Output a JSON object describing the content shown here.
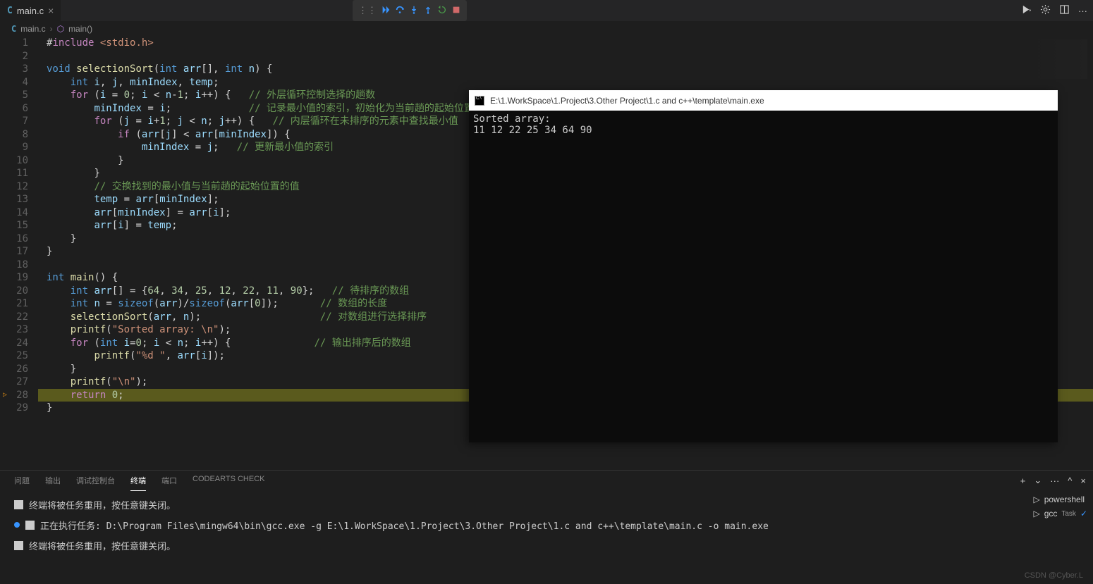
{
  "tab": {
    "filename": "main.c",
    "icon_letter": "C"
  },
  "breadcrumb": {
    "file": "main.c",
    "func": "main()"
  },
  "toolbar_icons": [
    "drag",
    "continue",
    "step-over",
    "step-into",
    "step-out",
    "restart",
    "stop"
  ],
  "right_icons": [
    "run-dropdown",
    "settings",
    "split",
    "more"
  ],
  "code": [
    {
      "n": 1,
      "html": "<span class='op'>#</span><span class='ctl'>include</span> <span class='str'>&lt;stdio.h&gt;</span>"
    },
    {
      "n": 2,
      "html": ""
    },
    {
      "n": 3,
      "html": "<span class='type'>void</span> <span class='fn'>selectionSort</span><span class='pn'>(</span><span class='type'>int</span> <span class='var'>arr</span><span class='pn'>[],</span> <span class='type'>int</span> <span class='var'>n</span><span class='pn'>)</span> <span class='pn'>{</span>"
    },
    {
      "n": 4,
      "html": "    <span class='type'>int</span> <span class='var'>i</span><span class='pn'>,</span> <span class='var'>j</span><span class='pn'>,</span> <span class='var'>minIndex</span><span class='pn'>,</span> <span class='var'>temp</span><span class='pn'>;</span>"
    },
    {
      "n": 5,
      "html": "    <span class='ctl'>for</span> <span class='pn'>(</span><span class='var'>i</span> <span class='op'>=</span> <span class='num'>0</span><span class='pn'>;</span> <span class='var'>i</span> <span class='op'>&lt;</span> <span class='var'>n</span><span class='op'>-</span><span class='num'>1</span><span class='pn'>;</span> <span class='var'>i</span><span class='op'>++</span><span class='pn'>)</span> <span class='pn'>{</span>   <span class='cmt'>// 外层循环控制选择的趟数</span>"
    },
    {
      "n": 6,
      "html": "        <span class='var'>minIndex</span> <span class='op'>=</span> <span class='var'>i</span><span class='pn'>;</span>             <span class='cmt'>// 记录最小值的索引，初始化为当前趟的起始位置</span>"
    },
    {
      "n": 7,
      "html": "        <span class='ctl'>for</span> <span class='pn'>(</span><span class='var'>j</span> <span class='op'>=</span> <span class='var'>i</span><span class='op'>+</span><span class='num'>1</span><span class='pn'>;</span> <span class='var'>j</span> <span class='op'>&lt;</span> <span class='var'>n</span><span class='pn'>;</span> <span class='var'>j</span><span class='op'>++</span><span class='pn'>)</span> <span class='pn'>{</span>   <span class='cmt'>// 内层循环在未排序的元素中查找最小值</span>"
    },
    {
      "n": 8,
      "html": "            <span class='ctl'>if</span> <span class='pn'>(</span><span class='var'>arr</span><span class='pn'>[</span><span class='var'>j</span><span class='pn'>]</span> <span class='op'>&lt;</span> <span class='var'>arr</span><span class='pn'>[</span><span class='var'>minIndex</span><span class='pn'>])</span> <span class='pn'>{</span>"
    },
    {
      "n": 9,
      "html": "                <span class='var'>minIndex</span> <span class='op'>=</span> <span class='var'>j</span><span class='pn'>;</span>   <span class='cmt'>// 更新最小值的索引</span>"
    },
    {
      "n": 10,
      "html": "            <span class='pn'>}</span>"
    },
    {
      "n": 11,
      "html": "        <span class='pn'>}</span>"
    },
    {
      "n": 12,
      "html": "        <span class='cmt'>// 交换找到的最小值与当前趟的起始位置的值</span>"
    },
    {
      "n": 13,
      "html": "        <span class='var'>temp</span> <span class='op'>=</span> <span class='var'>arr</span><span class='pn'>[</span><span class='var'>minIndex</span><span class='pn'>];</span>"
    },
    {
      "n": 14,
      "html": "        <span class='var'>arr</span><span class='pn'>[</span><span class='var'>minIndex</span><span class='pn'>]</span> <span class='op'>=</span> <span class='var'>arr</span><span class='pn'>[</span><span class='var'>i</span><span class='pn'>];</span>"
    },
    {
      "n": 15,
      "html": "        <span class='var'>arr</span><span class='pn'>[</span><span class='var'>i</span><span class='pn'>]</span> <span class='op'>=</span> <span class='var'>temp</span><span class='pn'>;</span>"
    },
    {
      "n": 16,
      "html": "    <span class='pn'>}</span>"
    },
    {
      "n": 17,
      "html": "<span class='pn'>}</span>"
    },
    {
      "n": 18,
      "html": ""
    },
    {
      "n": 19,
      "html": "<span class='type'>int</span> <span class='fn'>main</span><span class='pn'>()</span> <span class='pn'>{</span>"
    },
    {
      "n": 20,
      "html": "    <span class='type'>int</span> <span class='var'>arr</span><span class='pn'>[]</span> <span class='op'>=</span> <span class='pn'>{</span><span class='num'>64</span><span class='pn'>,</span> <span class='num'>34</span><span class='pn'>,</span> <span class='num'>25</span><span class='pn'>,</span> <span class='num'>12</span><span class='pn'>,</span> <span class='num'>22</span><span class='pn'>,</span> <span class='num'>11</span><span class='pn'>,</span> <span class='num'>90</span><span class='pn'>};</span>   <span class='cmt'>// 待排序的数组</span>"
    },
    {
      "n": 21,
      "html": "    <span class='type'>int</span> <span class='var'>n</span> <span class='op'>=</span> <span class='kw'>sizeof</span><span class='pn'>(</span><span class='var'>arr</span><span class='pn'>)/</span><span class='kw'>sizeof</span><span class='pn'>(</span><span class='var'>arr</span><span class='pn'>[</span><span class='num'>0</span><span class='pn'>]);</span>       <span class='cmt'>// 数组的长度</span>"
    },
    {
      "n": 22,
      "html": "    <span class='fn'>selectionSort</span><span class='pn'>(</span><span class='var'>arr</span><span class='pn'>,</span> <span class='var'>n</span><span class='pn'>);</span>                    <span class='cmt'>// 对数组进行选择排序</span>"
    },
    {
      "n": 23,
      "html": "    <span class='fn'>printf</span><span class='pn'>(</span><span class='str'>\"Sorted array: \\n\"</span><span class='pn'>);</span>"
    },
    {
      "n": 24,
      "html": "    <span class='ctl'>for</span> <span class='pn'>(</span><span class='type'>int</span> <span class='var'>i</span><span class='op'>=</span><span class='num'>0</span><span class='pn'>;</span> <span class='var'>i</span> <span class='op'>&lt;</span> <span class='var'>n</span><span class='pn'>;</span> <span class='var'>i</span><span class='op'>++</span><span class='pn'>)</span> <span class='pn'>{</span>              <span class='cmt'>// 输出排序后的数组</span>"
    },
    {
      "n": 25,
      "html": "        <span class='fn'>printf</span><span class='pn'>(</span><span class='str'>\"%d \"</span><span class='pn'>,</span> <span class='var'>arr</span><span class='pn'>[</span><span class='var'>i</span><span class='pn'>]);</span>"
    },
    {
      "n": 26,
      "html": "    <span class='pn'>}</span>"
    },
    {
      "n": 27,
      "html": "    <span class='fn'>printf</span><span class='pn'>(</span><span class='str'>\"\\n\"</span><span class='pn'>);</span>"
    },
    {
      "n": 28,
      "html": "    <span class='ctl'>return</span> <span class='num'>0</span><span class='pn'>;</span>",
      "hl": true,
      "bp": true
    },
    {
      "n": 29,
      "html": "<span class='pn'>}</span>"
    }
  ],
  "panel": {
    "tabs": [
      "问题",
      "输出",
      "调试控制台",
      "终端",
      "端口",
      "CODEARTS CHECK"
    ],
    "active": 3,
    "lines": [
      {
        "type": "x",
        "text": "终端将被任务重用，按任意键关闭。"
      },
      {
        "type": "dot",
        "text": "正在执行任务: D:\\Program Files\\mingw64\\bin\\gcc.exe -g E:\\1.WorkSpace\\1.Project\\3.Other Project\\1.c and c++\\template\\main.c -o main.exe"
      },
      {
        "type": "x",
        "text": "终端将被任务重用，按任意键关闭。"
      }
    ],
    "terminals": [
      {
        "icon": "ps",
        "label": "powershell"
      },
      {
        "icon": "ps",
        "label": "gcc",
        "task": "Task",
        "check": true
      }
    ]
  },
  "console": {
    "title": "E:\\1.WorkSpace\\1.Project\\3.Other Project\\1.c and c++\\template\\main.exe",
    "lines": [
      "Sorted array:",
      "11 12 22 25 34 64 90"
    ]
  },
  "watermark": "CSDN @Cyber.L"
}
